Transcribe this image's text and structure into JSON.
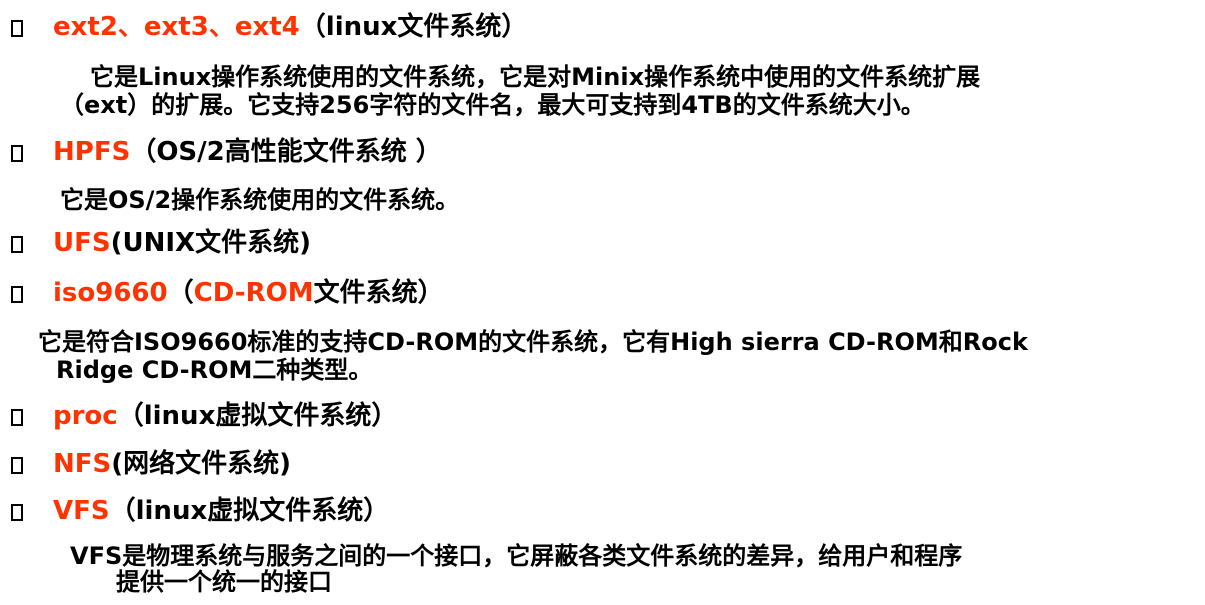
{
  "items": [
    {
      "term": "ext2、ext3、ext4",
      "rest": "（linux文件系统）",
      "desc": [
        "它是Linux操作系统使用的文件系统，它是对Minix操作系统中使用的文件系统扩展",
        "（ext）的扩展。它支持256字符的文件名，最大可支持到4TB的文件系统大小。"
      ]
    },
    {
      "term": "HPFS",
      "rest": "（OS/2高性能文件系统 ）",
      "desc": [
        "它是OS/2操作系统使用的文件系统。"
      ]
    },
    {
      "term": "UFS",
      "rest": "(UNIX文件系统)",
      "desc": []
    },
    {
      "term": "iso9660",
      "rest": "（CD-ROM文件系统）",
      "rest_highlight": "CD-ROM",
      "desc": [
        "它是符合ISO9660标准的支持CD-ROM的文件系统，它有High sierra CD-ROM和Rock",
        "Ridge CD-ROM二种类型。"
      ]
    },
    {
      "term": "proc",
      "rest": "（linux虚拟文件系统）",
      "desc": []
    },
    {
      "term": "NFS",
      "rest": "(网络文件系统)",
      "desc": []
    },
    {
      "term": "VFS",
      "rest": "（linux虚拟文件系统）",
      "desc": [
        "VFS是物理系统与服务之间的一个接口，它屏蔽各类文件系统的差异，给用户和程序",
        "提供一个统一的接口"
      ]
    }
  ],
  "colors": {
    "term": "#ff3300",
    "text": "#000000",
    "background": "#ffffff"
  },
  "icons": {
    "bullet": "hollow-square-bullet-icon"
  }
}
